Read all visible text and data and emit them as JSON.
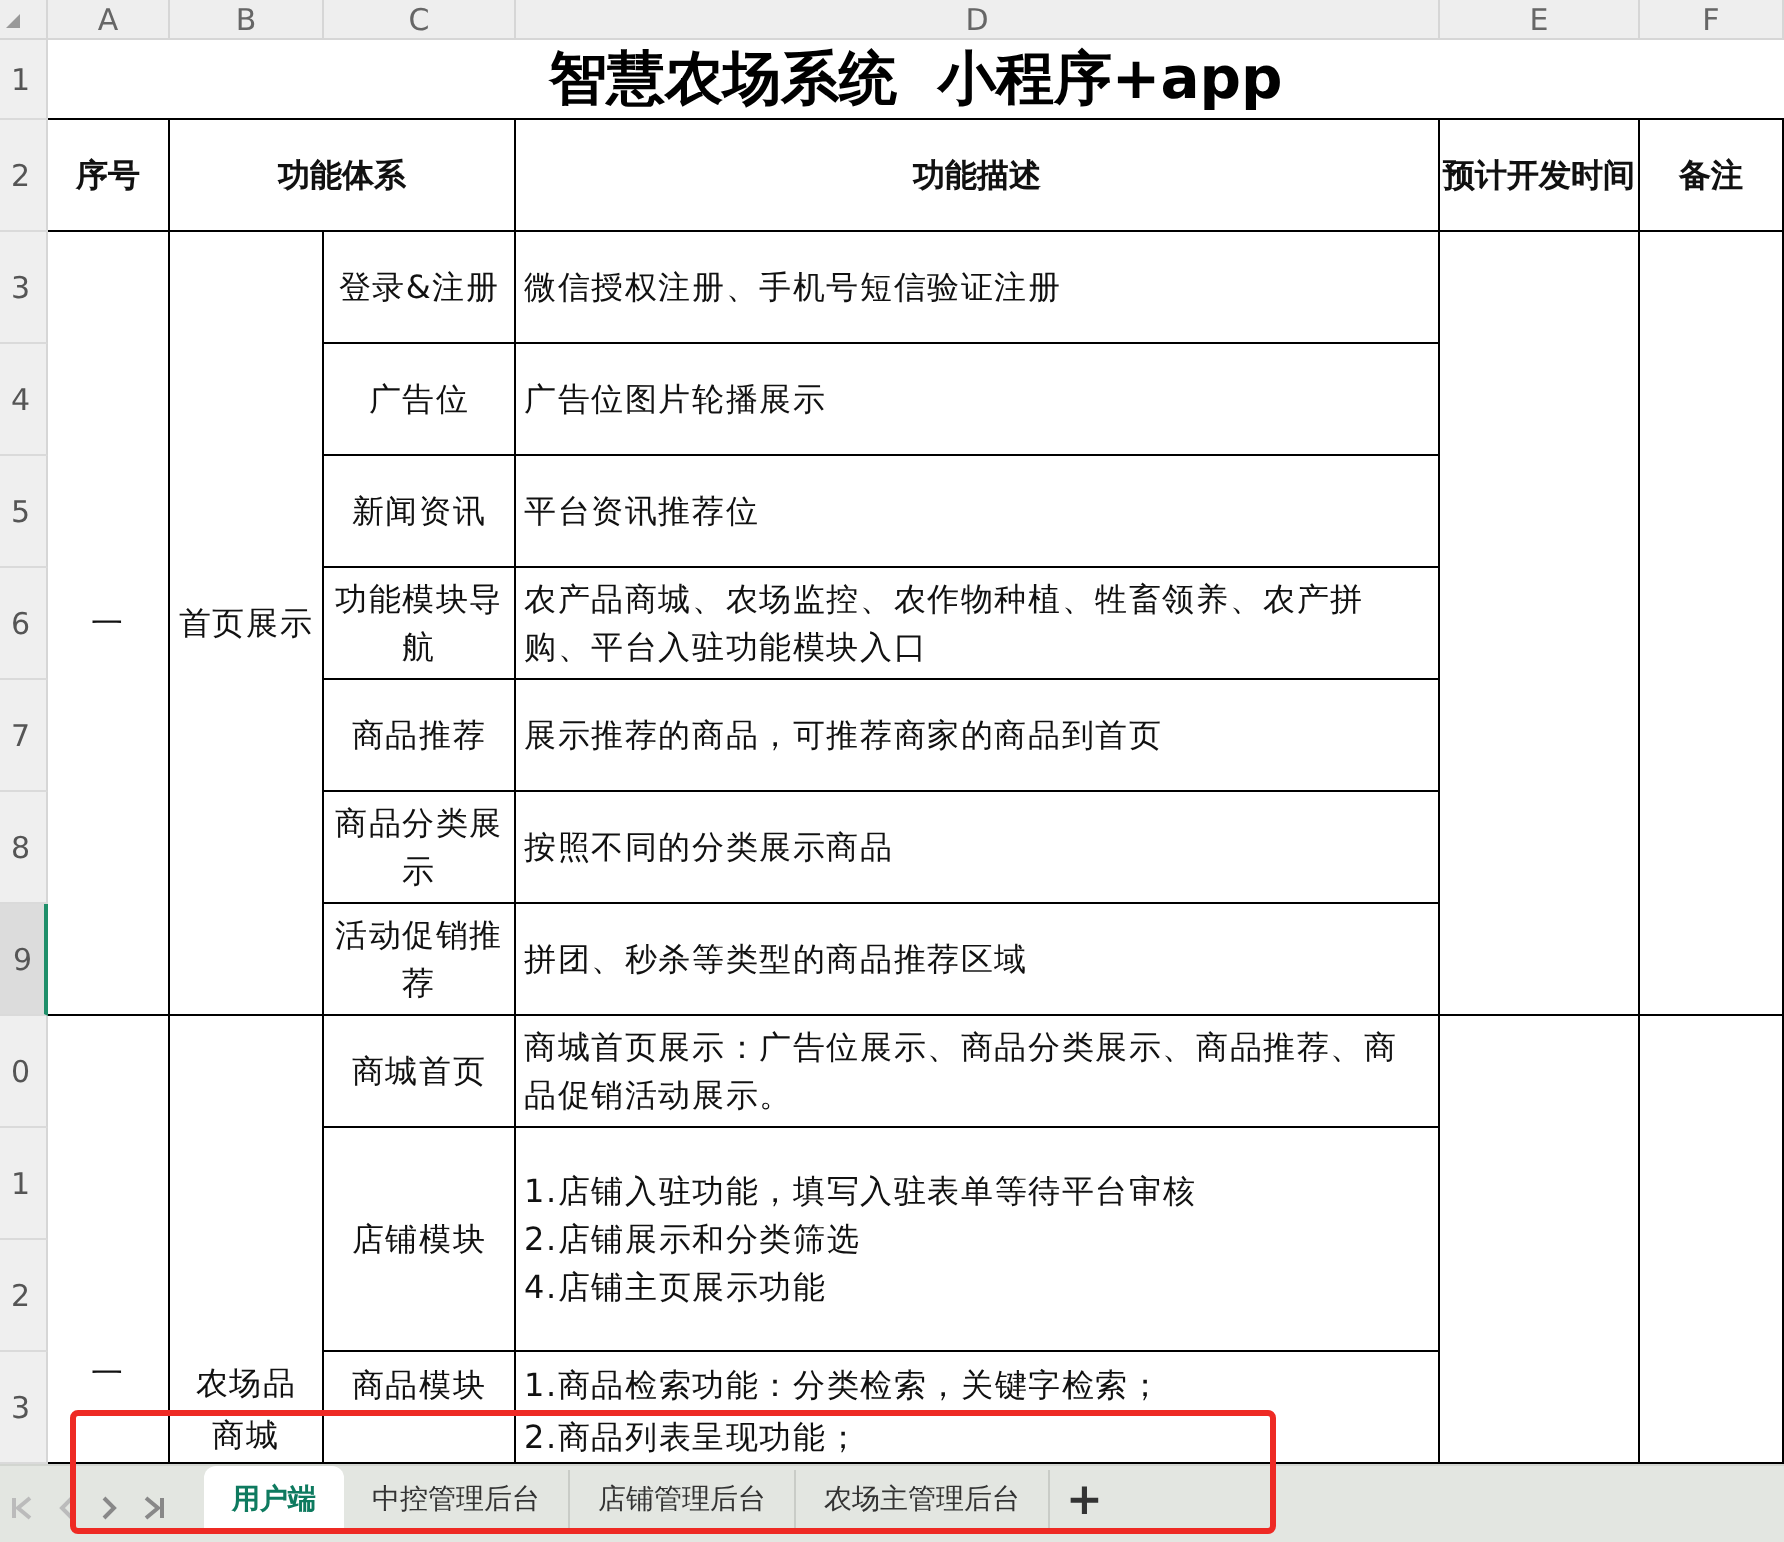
{
  "columns": [
    "A",
    "B",
    "C",
    "D",
    "E",
    "F"
  ],
  "row_headers": [
    {
      "label": "1",
      "selected": false
    },
    {
      "label": "2",
      "selected": false
    },
    {
      "label": "3",
      "selected": false
    },
    {
      "label": "4",
      "selected": false
    },
    {
      "label": "5",
      "selected": false
    },
    {
      "label": "6",
      "selected": false
    },
    {
      "label": "7",
      "selected": false
    },
    {
      "label": "8",
      "selected": false
    },
    {
      "label": "9",
      "selected": true
    },
    {
      "label": "0",
      "selected": false
    },
    {
      "label": "1",
      "selected": false
    },
    {
      "label": "2",
      "selected": false
    },
    {
      "label": "3",
      "selected": false
    }
  ],
  "title": "智慧农场系统  小程序+app",
  "headers": [
    "序号",
    "功能体系",
    "功能描述",
    "预计开发时间",
    "备注"
  ],
  "groups": [
    {
      "number": "一",
      "category": "首页展示",
      "continues": false,
      "items": [
        {
          "kind": "single",
          "feature": "登录&注册",
          "description": [
            "微信授权注册、手机号短信验证注册"
          ]
        },
        {
          "kind": "single",
          "feature": "广告位",
          "description": [
            "广告位图片轮播展示"
          ]
        },
        {
          "kind": "single",
          "feature": "新闻资讯",
          "description": [
            "平台资讯推荐位"
          ]
        },
        {
          "kind": "single",
          "feature": "功能模块导航",
          "description": [
            "农产品商城、农场监控、农作物种植、牲畜领养、农产拼购、平台入驻功能模块入口"
          ]
        },
        {
          "kind": "single",
          "feature": "商品推荐",
          "description": [
            "展示推荐的商品，可推荐商家的商品到首页"
          ]
        },
        {
          "kind": "single",
          "feature": "商品分类展示",
          "description": [
            "按照不同的分类展示商品"
          ]
        },
        {
          "kind": "single",
          "feature": "活动促销推荐",
          "description": [
            "拼团、秒杀等类型的商品推荐区域"
          ]
        }
      ]
    },
    {
      "number": "一",
      "category": "农场品商城",
      "continues": true,
      "items": [
        {
          "kind": "single",
          "feature": "商城首页",
          "description": [
            "商城首页展示：广告位展示、商品分类展示、商品推荐、商品促销活动展示。"
          ]
        },
        {
          "kind": "double",
          "feature": "店铺模块",
          "description": [
            "1.店铺入驻功能，填写入驻表单等待平台审核",
            "2.店铺展示和分类筛选",
            "4.店铺主页展示功能"
          ]
        },
        {
          "kind": "cut",
          "feature": "商品模块",
          "description": [
            "1.商品检索功能：分类检索，关键字检索；",
            "2.商品列表呈现功能；"
          ]
        }
      ]
    }
  ],
  "sheet_tabs": [
    {
      "label": "用户端",
      "selected": true
    },
    {
      "label": "中控管理后台",
      "selected": false
    },
    {
      "label": "店铺管理后台",
      "selected": false
    },
    {
      "label": "农场主管理后台",
      "selected": false
    }
  ],
  "add_tab": "+"
}
